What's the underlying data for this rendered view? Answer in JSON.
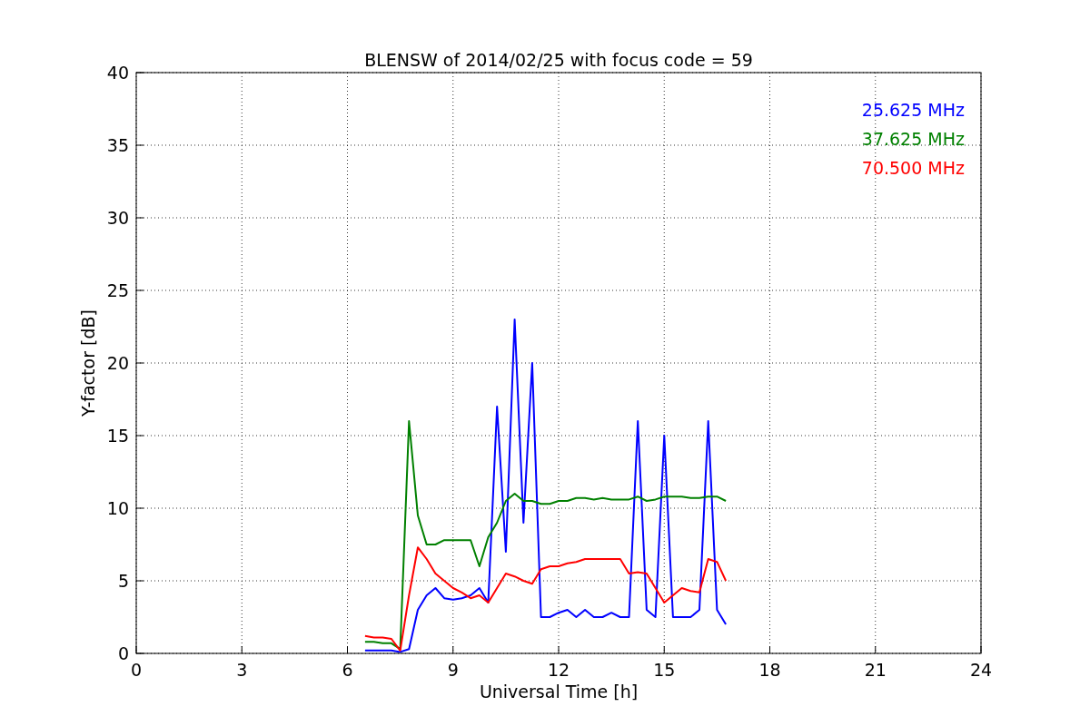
{
  "plot": {
    "chart_data": {
      "type": "line",
      "title": "BLENSW of 2014/02/25 with focus code = 59",
      "xlabel": "Universal Time [h]",
      "ylabel": "Y-factor [dB]",
      "x": [
        6.5,
        6.75,
        7,
        7.25,
        7.5,
        7.75,
        8,
        8.25,
        8.5,
        8.75,
        9,
        9.25,
        9.5,
        9.75,
        10,
        10.25,
        10.5,
        10.75,
        11,
        11.25,
        11.5,
        11.75,
        12,
        12.25,
        12.5,
        12.75,
        13,
        13.25,
        13.5,
        13.75,
        14,
        14.25,
        14.5,
        14.75,
        15,
        15.25,
        15.5,
        15.75,
        16,
        16.25,
        16.5,
        16.75
      ],
      "series": [
        {
          "name": "25.625 MHz",
          "color": "#0000ff",
          "values": [
            0.2,
            0.2,
            0.2,
            0.2,
            0.1,
            0.3,
            3,
            4,
            4.5,
            3.8,
            3.7,
            3.8,
            4,
            4.5,
            3.5,
            17,
            7,
            23,
            9,
            20,
            2.5,
            2.5,
            2.8,
            3,
            2.5,
            3,
            2.5,
            2.5,
            2.8,
            2.5,
            2.5,
            16,
            3,
            2.5,
            15,
            2.5,
            2.5,
            2.5,
            3,
            16,
            3,
            2
          ]
        },
        {
          "name": "37.625 MHz",
          "color": "#008000",
          "values": [
            0.8,
            0.8,
            0.7,
            0.7,
            0.3,
            16,
            9.5,
            7.5,
            7.5,
            7.8,
            7.8,
            7.8,
            7.8,
            6,
            8,
            9,
            10.5,
            11,
            10.5,
            10.5,
            10.3,
            10.3,
            10.5,
            10.5,
            10.7,
            10.7,
            10.6,
            10.7,
            10.6,
            10.6,
            10.6,
            10.8,
            10.5,
            10.6,
            10.8,
            10.8,
            10.8,
            10.7,
            10.7,
            10.8,
            10.8,
            10.5
          ]
        },
        {
          "name": "70.500 MHz",
          "color": "#ff0000",
          "values": [
            1.2,
            1.1,
            1.1,
            1.0,
            0.2,
            4,
            7.3,
            6.5,
            5.5,
            5,
            4.5,
            4.2,
            3.8,
            4,
            3.5,
            4.5,
            5.5,
            5.3,
            5,
            4.8,
            5.8,
            6,
            6,
            6.2,
            6.3,
            6.5,
            6.5,
            6.5,
            6.5,
            6.5,
            5.5,
            5.6,
            5.5,
            4.5,
            3.5,
            4,
            4.5,
            4.3,
            4.2,
            6.5,
            6.3,
            5
          ]
        }
      ],
      "xlim": [
        0,
        24
      ],
      "ylim": [
        0,
        40
      ],
      "xticks": [
        0,
        3,
        6,
        9,
        12,
        15,
        18,
        21,
        24
      ],
      "yticks": [
        0,
        5,
        10,
        15,
        20,
        25,
        30,
        35,
        40
      ],
      "grid": true
    }
  }
}
